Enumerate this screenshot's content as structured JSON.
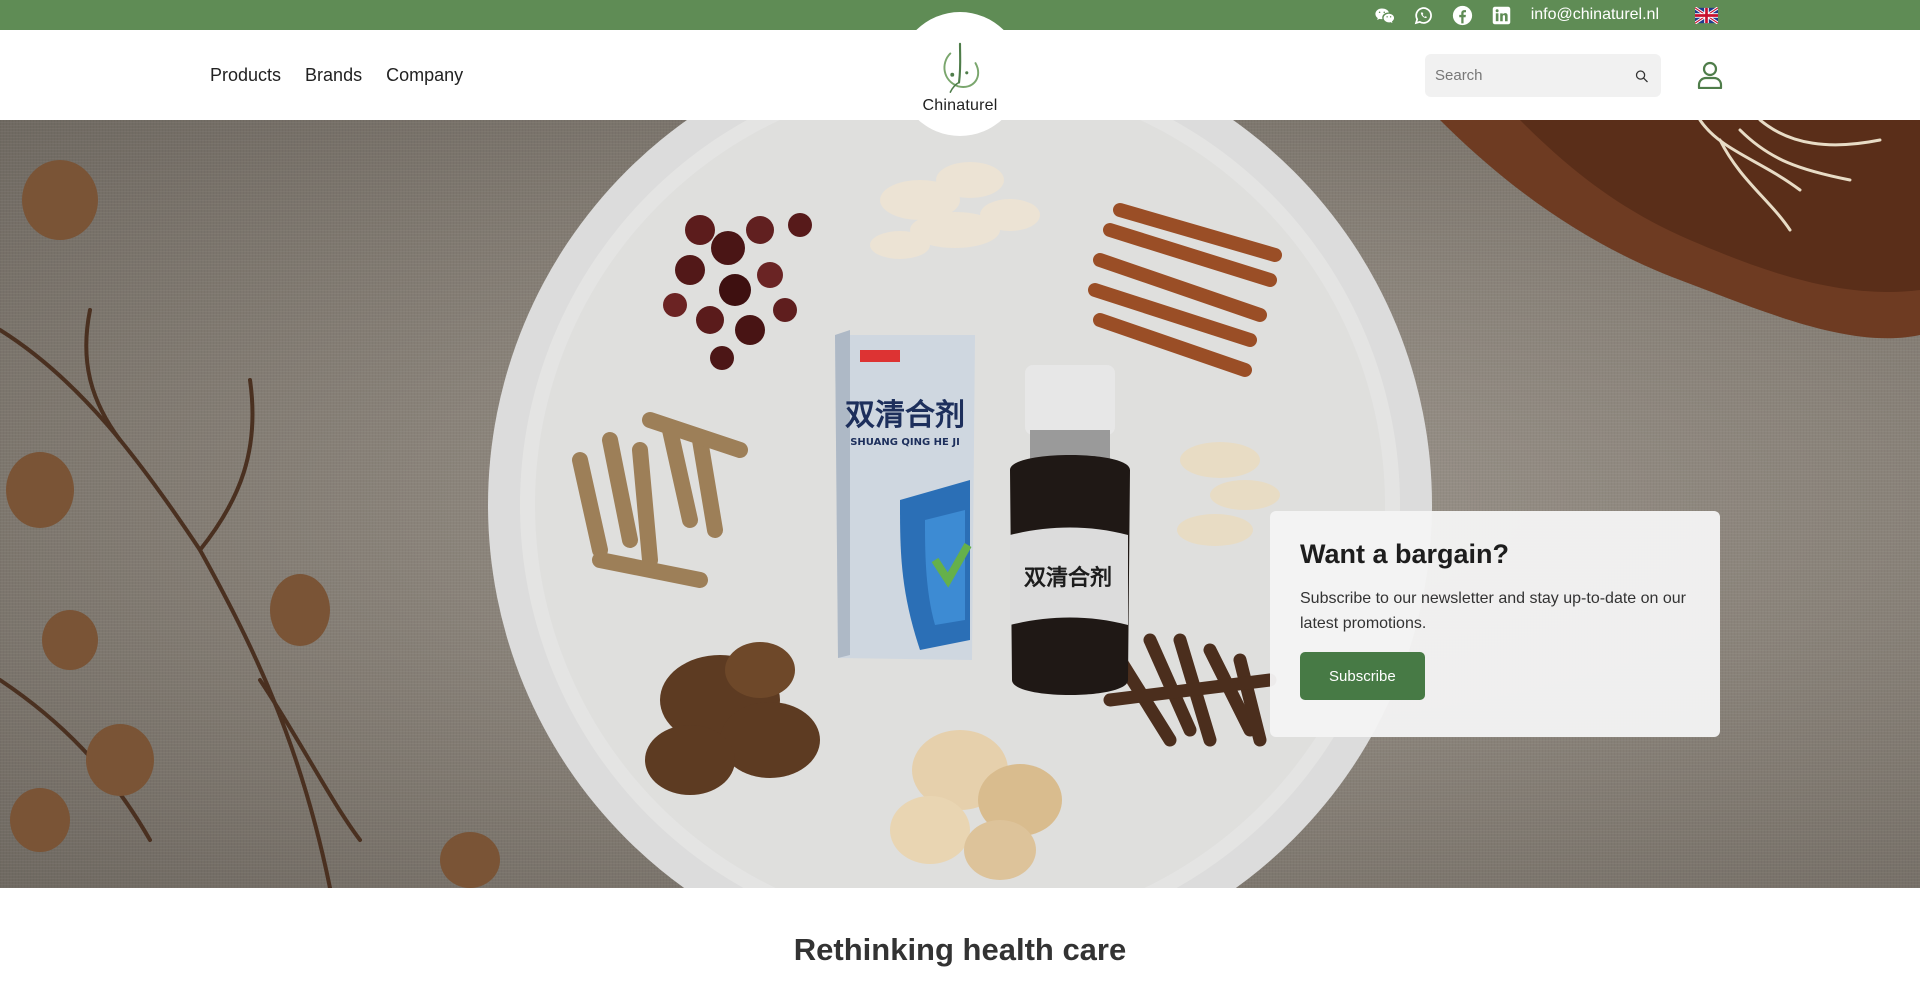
{
  "topbar": {
    "email": "info@chinaturel.nl",
    "icons": [
      "wechat-icon",
      "whatsapp-icon",
      "facebook-icon",
      "linkedin-icon"
    ],
    "language_flag": "uk-flag",
    "background_color": "#5f8c55"
  },
  "header": {
    "nav": [
      {
        "label": "Products"
      },
      {
        "label": "Brands"
      },
      {
        "label": "Company"
      }
    ],
    "logo_text": "Chinaturel",
    "search_placeholder": "Search"
  },
  "hero": {
    "product_label": "双清合剂",
    "product_label_latin": "SHUANG QING HE JI"
  },
  "promo": {
    "title": "Want a bargain?",
    "text": "Subscribe to our newsletter and stay up-to-date on our latest promotions.",
    "button_label": "Subscribe",
    "button_color": "#477a45"
  },
  "section": {
    "title": "Rethinking health care"
  }
}
